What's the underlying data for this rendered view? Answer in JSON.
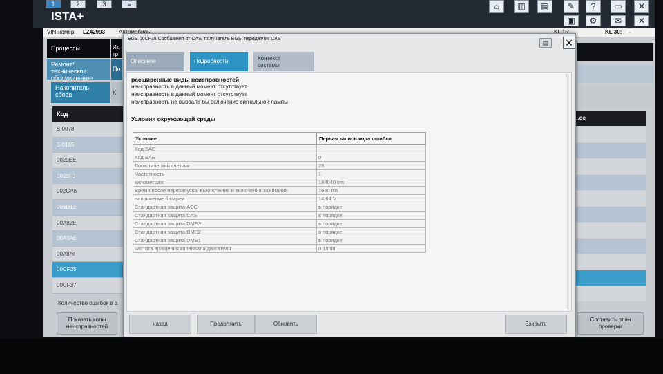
{
  "window_tabs": [
    "1",
    "2",
    "3",
    "≡"
  ],
  "app_title": "ISTA+",
  "toolbar_icons": [
    "home-icon",
    "cards-icon",
    "printer-icon",
    "wrench-icon",
    "help-icon",
    "minimize-icon",
    "close-icon"
  ],
  "vehicle_info": {
    "vin_label": "VIN-номер:",
    "vin_value": "LZ42993",
    "vehicle_text": "Автомобиль: ...",
    "kl15_label": "KL 15: ...",
    "kl30_label": "KL 30:",
    "kl30_value": "–"
  },
  "left_menu": {
    "processes": "Процессы",
    "processes_right": "Ид\nтр",
    "repair": "Ремонт/\nтехническое\nобслуживание",
    "repair_right": "По",
    "memory": "Накопитель\nсбоев",
    "memory_right": "К"
  },
  "code_list": {
    "header": "Код",
    "rows": [
      "S 0078",
      "S 0165",
      "0029EE",
      "0029F0",
      "002CA8",
      "009D12",
      "00A82E",
      "00A8AE",
      "00A8AF",
      "00CF35",
      "00CF37"
    ],
    "selected_index": 9,
    "count_label": "Количество ошибок в а"
  },
  "right_panel": {
    "header": "...ос"
  },
  "bottom_buttons": {
    "show_codes": "Показать коды\nнеисправностей",
    "make_plan": "Составить план\nпроверки"
  },
  "dialog": {
    "title": "EGS 00CF35 Сообщения от CAS, получатель EGS, передатчик CAS",
    "tabs": {
      "description": "Описание",
      "details": "Подробности",
      "context": "Контекст\nсистемы"
    },
    "active_tab": "details",
    "extended_heading": "расширенные виды неисправностей",
    "extended_lines": [
      "неисправность в данный момент отсутствует",
      "неисправность в данный момент отсутствует",
      "неисправность не вызвала бы включение сигнальной лампы"
    ],
    "env_heading": "Условия окружающей среды",
    "table": {
      "col_condition": "Условие",
      "col_first": "Первая запись кода ошибки",
      "rows": [
        {
          "cond": "Код SAE",
          "val": "--"
        },
        {
          "cond": "Код SAE",
          "val": "0"
        },
        {
          "cond": "Логистический счетчик",
          "val": "28"
        },
        {
          "cond": "Частотность",
          "val": "1"
        },
        {
          "cond": "километраж",
          "val": "184040 km"
        },
        {
          "cond": "Время после перезапуска/ выключения и включения зажигания",
          "val": "7650 ms"
        },
        {
          "cond": "напряжение батареи",
          "val": "14.64 V"
        },
        {
          "cond": "Стандартная защита ACC",
          "val": "в порядке"
        },
        {
          "cond": "Стандартная защита CAS",
          "val": "в порядке"
        },
        {
          "cond": "Стандартная защита DME3",
          "val": "в порядке"
        },
        {
          "cond": "Стандартная защита DME2",
          "val": "в порядке"
        },
        {
          "cond": "Стандартная защита DME1",
          "val": "в порядке"
        },
        {
          "cond": "частота вращения коленвала двигателя",
          "val": "0 1/min"
        }
      ]
    },
    "buttons": {
      "back": "назад",
      "continue": "Продолжить",
      "refresh": "Обновить",
      "close": "Закрыть"
    }
  }
}
